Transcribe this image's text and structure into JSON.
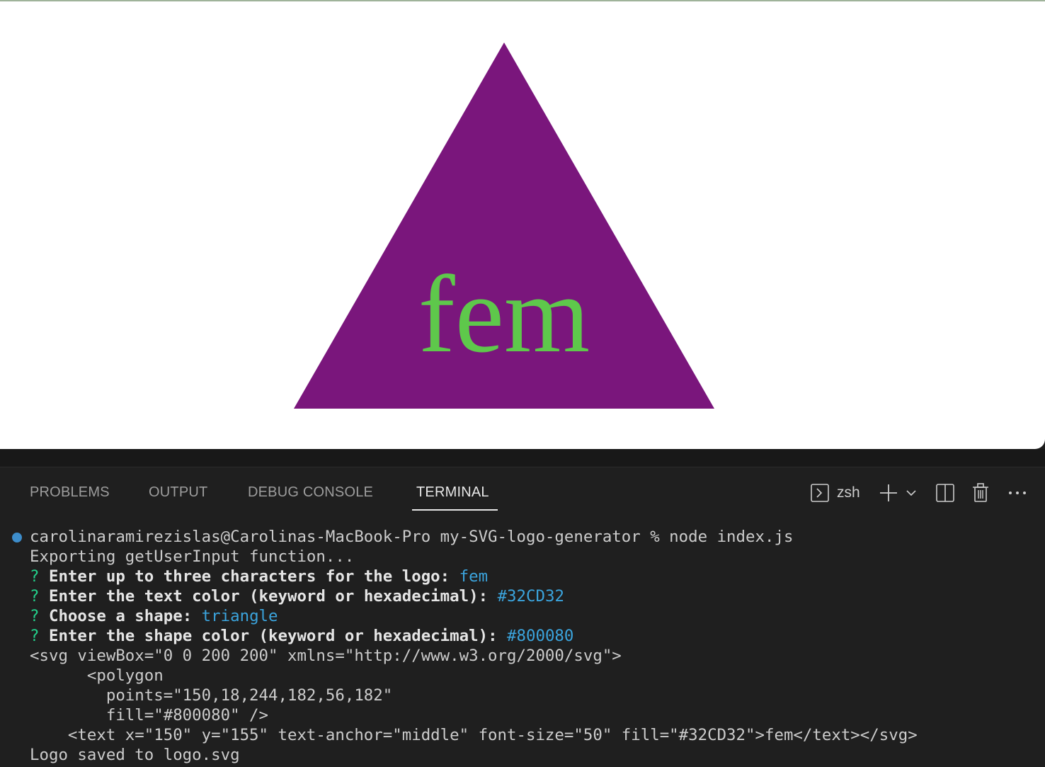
{
  "preview": {
    "logo_text": "fem",
    "shape_color": "#7a167c",
    "text_color": "#5ec84b"
  },
  "panel": {
    "tabs": [
      {
        "label": "PROBLEMS"
      },
      {
        "label": "OUTPUT"
      },
      {
        "label": "DEBUG CONSOLE"
      },
      {
        "label": "TERMINAL"
      }
    ],
    "active_tab": "TERMINAL",
    "shell": "zsh"
  },
  "terminal": {
    "prompt": "carolinaramirezislas@Carolinas-MacBook-Pro my-SVG-logo-generator % node index.js",
    "log1": "Exporting getUserInput function...",
    "questions": [
      {
        "mark": "?",
        "text": "Enter up to three characters for the logo:",
        "answer": "fem"
      },
      {
        "mark": "?",
        "text": "Enter the text color (keyword or hexadecimal):",
        "answer": "#32CD32"
      },
      {
        "mark": "?",
        "text": "Choose a shape:",
        "answer": "triangle"
      },
      {
        "mark": "?",
        "text": "Enter the shape color (keyword or hexadecimal):",
        "answer": "#800080"
      }
    ],
    "svg_lines": [
      "<svg viewBox=\"0 0 200 200\" xmlns=\"http://www.w3.org/2000/svg\">",
      "      <polygon",
      "        points=\"150,18,244,182,56,182\"",
      "        fill=\"#800080\" />",
      "    <text x=\"150\" y=\"155\" text-anchor=\"middle\" font-size=\"50\" fill=\"#32CD32\">fem</text></svg>"
    ],
    "saved": "Logo saved to logo.svg"
  }
}
